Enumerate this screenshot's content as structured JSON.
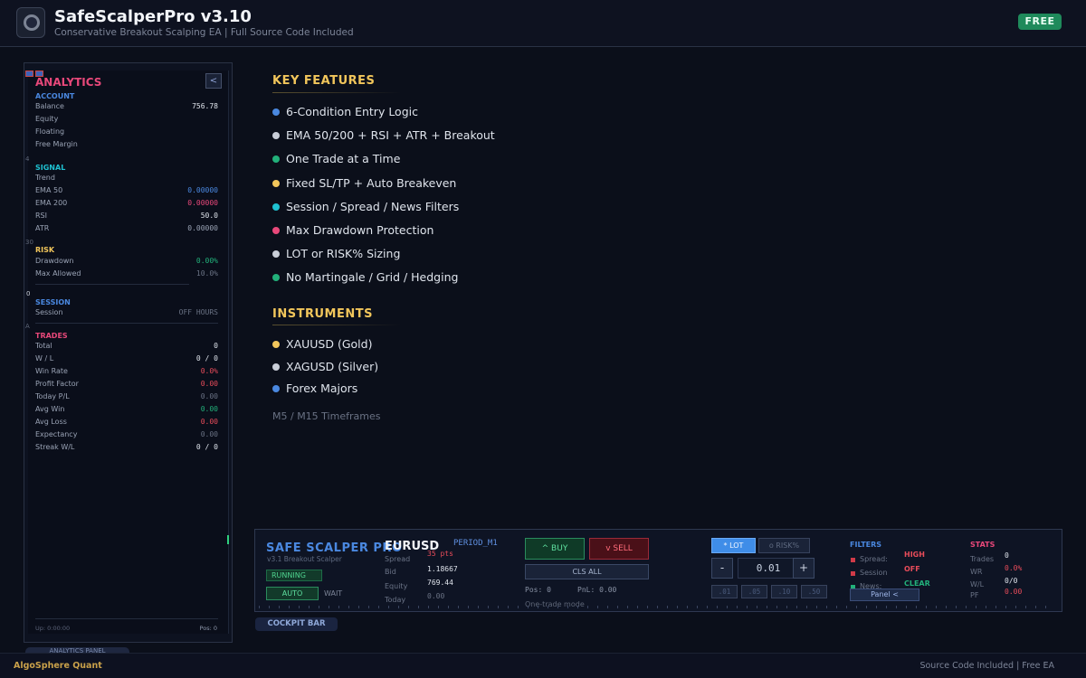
{
  "header": {
    "title": "SafeScalperPro v3.10",
    "subtitle": "Conservative Breakout Scalping EA  |  Full Source Code Included",
    "badge": "FREE"
  },
  "analytics": {
    "title": "ANALYTICS",
    "collapse": "<",
    "account": {
      "heading": "ACCOUNT",
      "balance_label": "Balance",
      "balance": "756.78",
      "equity_label": "Equity",
      "floating_label": "Floating",
      "free_margin_label": "Free Margin"
    },
    "signal": {
      "heading": "SIGNAL",
      "trend_label": "Trend",
      "ema50_label": "EMA 50",
      "ema50": "0.00000",
      "ema200_label": "EMA 200",
      "ema200": "0.00000",
      "rsi_label": "RSI",
      "rsi": "50.0",
      "atr_label": "ATR",
      "atr": "0.00000"
    },
    "risk": {
      "heading": "RISK",
      "drawdown_label": "Drawdown",
      "drawdown": "0.00%",
      "max_allowed_label": "Max Allowed",
      "max_allowed": "10.0%"
    },
    "session": {
      "heading": "SESSION",
      "session_label": "Session",
      "session": "OFF HOURS"
    },
    "trades": {
      "heading": "TRADES",
      "total_label": "Total",
      "total": "0",
      "wl_label": "W / L",
      "wl": "0 / 0",
      "win_rate_label": "Win Rate",
      "win_rate": "0.0%",
      "profit_factor_label": "Profit Factor",
      "profit_factor": "0.00",
      "today_pl_label": "Today P/L",
      "today_pl": "0.00",
      "avg_win_label": "Avg Win",
      "avg_win": "0.00",
      "avg_loss_label": "Avg Loss",
      "avg_loss": "0.00",
      "expectancy_label": "Expectancy",
      "expectancy": "0.00",
      "streak_label": "Streak W/L",
      "streak": "0 / 0"
    },
    "footer_left": "Up: 0:00:00",
    "footer_right": "Pos: 0",
    "stray": [
      "4",
      "30",
      "0",
      "A"
    ],
    "panel_label": "ANALYTICS PANEL"
  },
  "features": {
    "key_title": "KEY FEATURES",
    "items": [
      {
        "text": "6-Condition Entry Logic",
        "color": "#4a88e0"
      },
      {
        "text": "EMA 50/200 + RSI + ATR + Breakout",
        "color": "#c9ced8"
      },
      {
        "text": "One Trade at a Time",
        "color": "#22b07a"
      },
      {
        "text": "Fixed SL/TP + Auto Breakeven",
        "color": "#f2c65b"
      },
      {
        "text": "Session / Spread / News Filters",
        "color": "#1fc1d1"
      },
      {
        "text": "Max Drawdown Protection",
        "color": "#e8487a"
      },
      {
        "text": "LOT or RISK% Sizing",
        "color": "#c9ced8"
      },
      {
        "text": "No Martingale / Grid / Hedging",
        "color": "#22b07a"
      }
    ],
    "instruments_title": "INSTRUMENTS",
    "instruments": [
      {
        "text": "XAUUSD (Gold)",
        "color": "#f2c65b"
      },
      {
        "text": "XAGUSD (Silver)",
        "color": "#c9ced8"
      },
      {
        "text": "Forex Majors",
        "color": "#4a88e0"
      }
    ],
    "timeframes": "M5 / M15 Timeframes"
  },
  "cockpit": {
    "brand": "SAFE SCALPER PRO",
    "version": "v3.1 Breakout Scalper",
    "status": "RUNNING",
    "mode": "AUTO",
    "wait": "WAIT",
    "symbol": "EURUSD",
    "period": "PERIOD_M1",
    "spread_label": "Spread",
    "spread": "35 pts",
    "bid_label": "Bid",
    "bid": "1.18667",
    "equity_label": "Equity",
    "equity": "769.44",
    "today_label": "Today",
    "today": "0.00",
    "buy": "^ BUY",
    "sell": "v SELL",
    "close_all": "CLS ALL",
    "pos": "Pos: 0",
    "pnl": "PnL: 0.00",
    "one_trade": "One-trade mode",
    "lot_toggle": "* LOT",
    "risk_toggle": "o RISK%",
    "minus": "-",
    "lot_value": "0.01",
    "plus": "+",
    "presets": [
      ".01",
      ".05",
      ".10",
      ".50"
    ],
    "filters_title": "FILTERS",
    "spread_filter_label": "Spread:",
    "spread_filter": "HIGH",
    "session_filter_label": "Session",
    "session_filter": "OFF",
    "news_filter_label": "News:",
    "news_filter": "CLEAR",
    "panel_toggle": "Panel <",
    "stats_title": "STATS",
    "trades_label": "Trades",
    "trades": "0",
    "wr_label": "WR",
    "wr": "0.0%",
    "wl_label": "W/L",
    "wl": "0/0",
    "pf_label": "PF",
    "pf": "0.00",
    "label": "COCKPIT BAR"
  },
  "footer": {
    "brand": "AlgoSphere Quant",
    "note": "Source Code Included  |  Free EA"
  }
}
